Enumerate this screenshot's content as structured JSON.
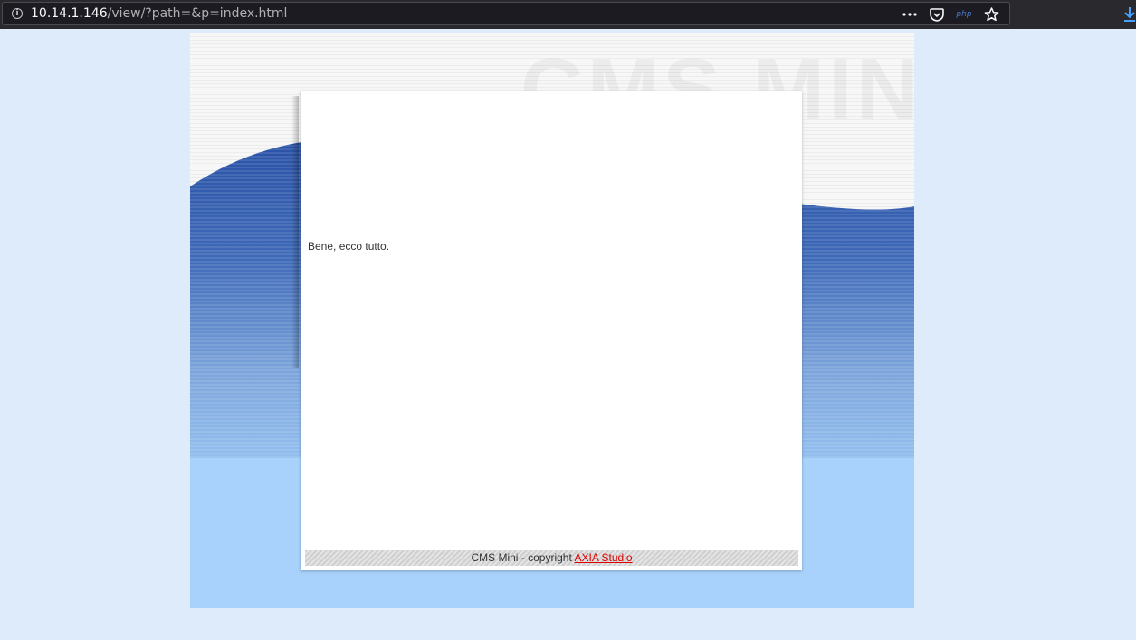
{
  "browser": {
    "url_host": "10.14.1.146",
    "url_path": "/view/?path=&p=index.html",
    "more_icon": "ellipsis-icon",
    "pocket_icon": "pocket-icon",
    "php_label": "php",
    "bookmark_icon": "star-icon",
    "download_icon": "download-icon"
  },
  "page": {
    "watermark": "CMS MINI",
    "body_text": "Bene, ecco tutto.",
    "footer_prefix": "CMS Mini - copyright",
    "footer_link": "AXIA Studio"
  },
  "colors": {
    "page_bg": "#ddebfa",
    "wave_dark": "#2a54a8",
    "wave_light": "#a8d2fb",
    "link": "#dd0000"
  }
}
